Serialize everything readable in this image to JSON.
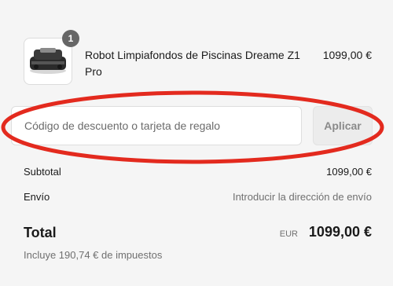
{
  "product": {
    "quantity": "1",
    "name": "Robot Limpiafondos de Piscinas Dreame Z1 Pro",
    "price": "1099,00 €"
  },
  "discount": {
    "placeholder": "Código de descuento o tarjeta de regalo",
    "apply_label": "Aplicar"
  },
  "summary": {
    "subtotal_label": "Subtotal",
    "subtotal_value": "1099,00 €",
    "shipping_label": "Envío",
    "shipping_value": "Introducir la dirección de envío",
    "total_label": "Total",
    "total_currency": "EUR",
    "total_value": "1099,00 €",
    "tax_note": "Incluye 190,74 € de impuestos"
  },
  "colors": {
    "annotation": "#e32a1e",
    "badge": "#666666",
    "background": "#f5f5f5"
  }
}
